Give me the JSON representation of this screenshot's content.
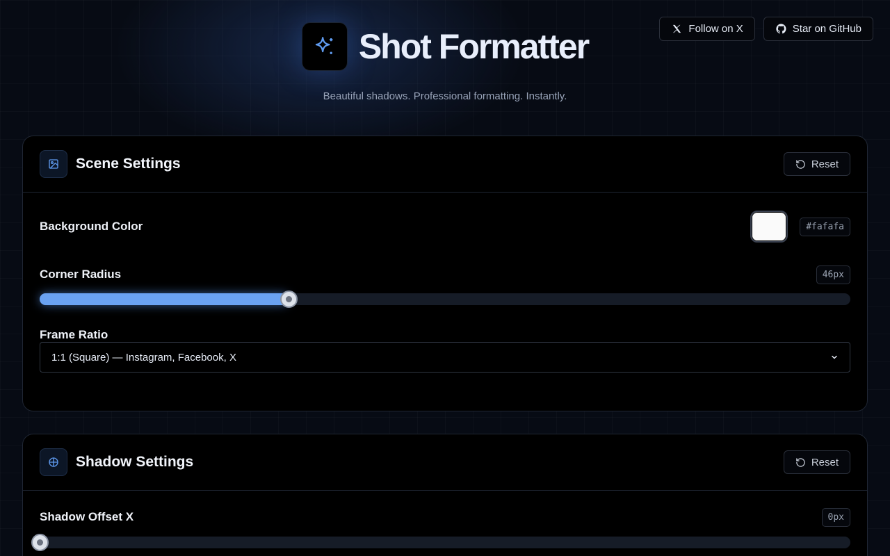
{
  "top_links": {
    "follow_label": "Follow on X",
    "github_label": "Star on GitHub"
  },
  "hero": {
    "title": "Shot Formatter",
    "tagline": "Beautiful shadows. Professional formatting. Instantly."
  },
  "scene": {
    "title": "Scene Settings",
    "reset_label": "Reset",
    "background_color": {
      "label": "Background Color",
      "value": "#fafafa"
    },
    "corner_radius": {
      "label": "Corner Radius",
      "value_text": "46px",
      "fraction": 0.307
    },
    "frame_ratio": {
      "label": "Frame Ratio",
      "selected": "1:1 (Square) — Instagram, Facebook, X"
    }
  },
  "shadow": {
    "title": "Shadow Settings",
    "reset_label": "Reset",
    "offset_x": {
      "label": "Shadow Offset X",
      "value_text": "0px",
      "fraction": 0
    }
  },
  "colors": {
    "accent": "#6aa2f2",
    "background": "#070b14",
    "card": "#000000"
  },
  "icons": {
    "follow": "x-logo-icon",
    "github": "github-icon",
    "logo": "sparkle-icon",
    "scene": "image-icon",
    "shadow": "crosshair-icon",
    "reset": "rotate-ccw-icon",
    "select": "chevron-down-icon"
  }
}
